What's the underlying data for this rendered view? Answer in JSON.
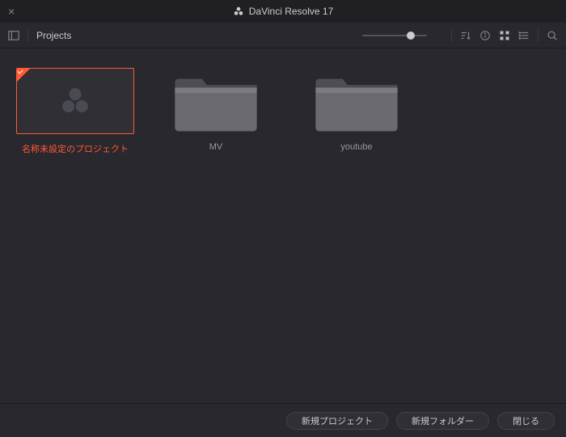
{
  "title": "DaVinci Resolve 17",
  "breadcrumb": "Projects",
  "items": [
    {
      "label": "名称未設定のプロジェクト",
      "type": "project",
      "selected": true
    },
    {
      "label": "MV",
      "type": "folder"
    },
    {
      "label": "youtube",
      "type": "folder"
    }
  ],
  "footer": {
    "new_project": "新規プロジェクト",
    "new_folder": "新規フォルダー",
    "close": "閉じる"
  }
}
